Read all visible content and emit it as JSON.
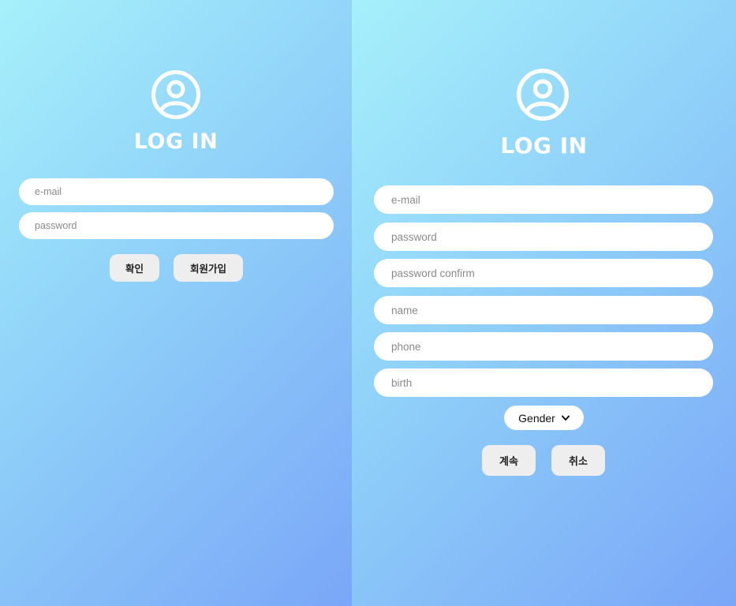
{
  "left_form": {
    "title": "LOG IN",
    "fields": [
      {
        "placeholder": "e-mail"
      },
      {
        "placeholder": "password"
      }
    ],
    "buttons": {
      "confirm": "확인",
      "signup": "회원가입"
    }
  },
  "right_form": {
    "title": "LOG IN",
    "fields": [
      {
        "placeholder": "e-mail"
      },
      {
        "placeholder": "password"
      },
      {
        "placeholder": "password confirm"
      },
      {
        "placeholder": "name"
      },
      {
        "placeholder": "phone"
      },
      {
        "placeholder": "birth"
      }
    ],
    "gender_select": {
      "selected": "Gender"
    },
    "buttons": {
      "continue": "계속",
      "cancel": "취소"
    }
  },
  "icons": {
    "user": "user-circle-icon",
    "dropdown": "chevron-down-icon"
  },
  "colors": {
    "gradient_start": "#a6f0fb",
    "gradient_end": "#7aa6f7",
    "field_bg": "#ffffff",
    "button_bg": "#eeeeee"
  }
}
